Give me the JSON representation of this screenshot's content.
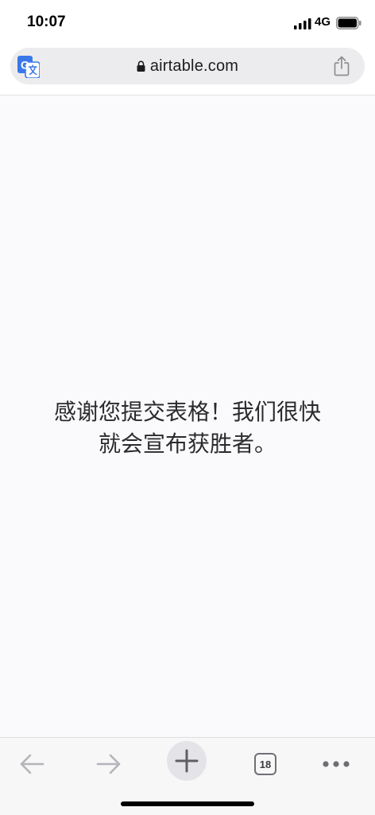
{
  "status_bar": {
    "time": "10:07",
    "network": "4G",
    "icons": [
      "signal-icon",
      "battery-icon"
    ]
  },
  "address_bar": {
    "url": "airtable.com",
    "icons": [
      "translate-icon",
      "lock-icon",
      "share-icon"
    ]
  },
  "page": {
    "message_line_1": "感谢您提交表格！我们很快",
    "message_line_2": "就会宣布获胜者。"
  },
  "toolbar": {
    "tab_count": "18",
    "icons": [
      "back-arrow-icon",
      "forward-arrow-icon",
      "plus-icon",
      "tabs-icon",
      "more-dots-icon"
    ]
  },
  "colors": {
    "accent": "#1a73e8",
    "toolbar_icon": "#9d9da2",
    "page_background": "#fafafc"
  }
}
